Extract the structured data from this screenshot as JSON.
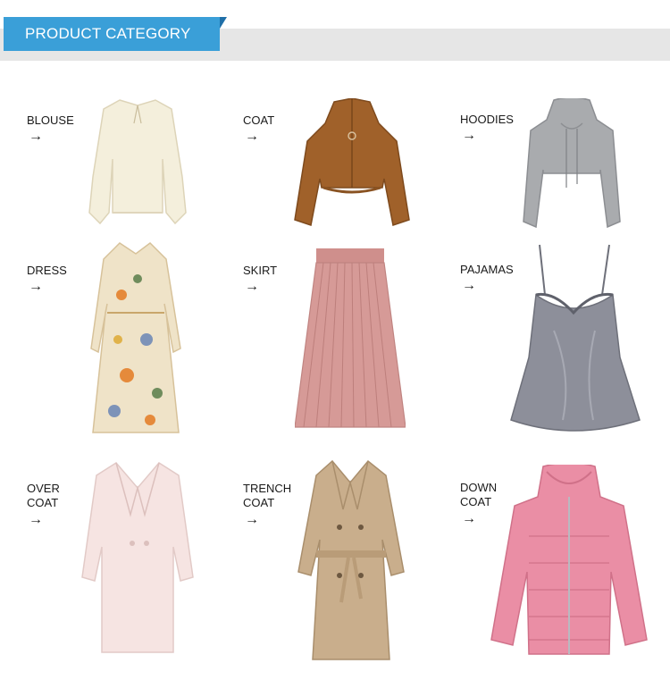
{
  "header": {
    "title": "PRODUCT CATEGORY"
  },
  "categories": [
    {
      "label": "BLOUSE",
      "arrow": "→"
    },
    {
      "label": "COAT",
      "arrow": "→"
    },
    {
      "label": "HOODIES",
      "arrow": "→"
    },
    {
      "label": "DRESS",
      "arrow": "→"
    },
    {
      "label": "SKIRT",
      "arrow": "→"
    },
    {
      "label": "PAJAMAS",
      "arrow": "→"
    },
    {
      "label": "OVER\nCOAT",
      "arrow": "→"
    },
    {
      "label": "TRENCH\nCOAT",
      "arrow": "→"
    },
    {
      "label": "DOWN\nCOAT",
      "arrow": "→"
    }
  ],
  "colors": {
    "accent": "#3a9fd8",
    "header_bar": "#e6e6e6",
    "blouse": "#f4efdc",
    "coat": "#a0612a",
    "hoodie": "#a9abae",
    "dress_bg": "#efe3c8",
    "skirt": "#d69a97",
    "pajamas": "#8d8f9a",
    "overcoat": "#f6e4e2",
    "trench": "#c9ae8c",
    "downcoat": "#ea8ea5"
  }
}
